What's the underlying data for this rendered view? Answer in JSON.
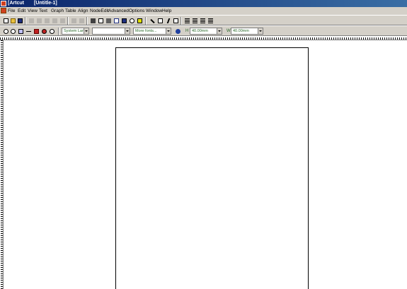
{
  "window": {
    "app_title": "[Artcut",
    "doc_title": "[Untitle-1]"
  },
  "menu": {
    "items": [
      "File",
      "Edit",
      "View",
      "Text",
      "Graph",
      "Table",
      "Align",
      "NodeEdit",
      "Advanced",
      "Options",
      "Window",
      "Help"
    ]
  },
  "toolbar_top": {
    "buttons": [
      {
        "name": "new-icon",
        "enabled": true
      },
      {
        "name": "open-icon",
        "enabled": true
      },
      {
        "name": "save-icon",
        "enabled": true
      },
      {
        "name": "cut-icon",
        "enabled": false
      },
      {
        "name": "copy-icon",
        "enabled": false
      },
      {
        "name": "paste-icon",
        "enabled": false
      },
      {
        "name": "delete-icon",
        "enabled": false
      },
      {
        "name": "undo-icon",
        "enabled": false
      },
      {
        "name": "redo-icon",
        "enabled": false
      },
      {
        "name": "import-icon",
        "enabled": false
      },
      {
        "name": "export-icon",
        "enabled": true
      },
      {
        "name": "print-icon",
        "enabled": true
      },
      {
        "name": "preview-icon",
        "enabled": true
      },
      {
        "name": "plot-icon",
        "enabled": true
      },
      {
        "name": "bulb-icon",
        "enabled": true
      },
      {
        "name": "help-icon",
        "enabled": true
      },
      {
        "name": "node-edit-icon",
        "enabled": true
      },
      {
        "name": "text-tool-icon",
        "enabled": true
      },
      {
        "name": "italic-icon",
        "enabled": true
      },
      {
        "name": "text-box-icon",
        "enabled": true
      },
      {
        "name": "align-left-icon",
        "enabled": true
      },
      {
        "name": "align-center-icon",
        "enabled": true
      },
      {
        "name": "align-right-icon",
        "enabled": true
      },
      {
        "name": "justify-icon",
        "enabled": true
      }
    ]
  },
  "toolbar_bottom": {
    "font_combo": "System Lan",
    "size_combo": "",
    "more_fonts": "More fonts...",
    "h_label": "H",
    "h_value": "40.00mm",
    "w_label": "W",
    "w_value": "40.00mm"
  },
  "colors": {
    "titlebar": "#0a246a",
    "chrome": "#d4d0c8",
    "field_text": "#2a6a2a"
  }
}
